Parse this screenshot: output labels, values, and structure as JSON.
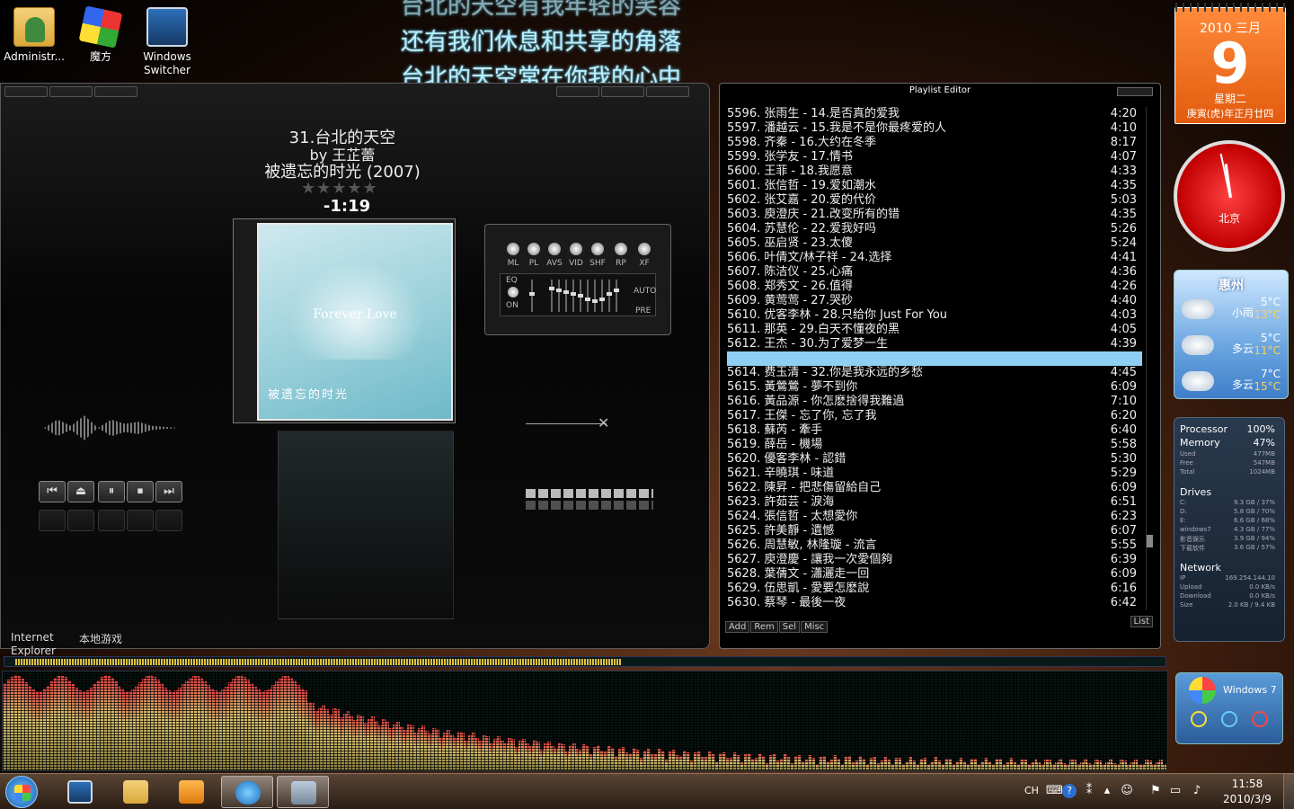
{
  "desktop": {
    "icons": [
      {
        "label": "Administr..."
      },
      {
        "label": "魔方"
      },
      {
        "label": "Windows Switcher"
      }
    ],
    "bottom_labels": {
      "ie": "Internet Explorer",
      "games": "本地游戏"
    }
  },
  "lyrics": {
    "line_prev": "台北的天空有我年轻的笑容",
    "line1": "还有我们休息和共享的角落",
    "line2": "台北的天空常在你我的心中"
  },
  "player": {
    "title": "31.台北的天空",
    "artist": "by 王芷蕾",
    "album": "被遗忘的时光 (2007)",
    "stars": "★★★★★",
    "time": "-1:19",
    "cover_title": "Forever Love",
    "cover_subtitle": "被遗忘的时光",
    "mini_labels": [
      "ML",
      "PL",
      "AVS",
      "VID",
      "SHF",
      "RP",
      "XF"
    ],
    "eq_label": "EQ",
    "eq_on": "ON",
    "eq_auto": "AUTO",
    "eq_pre": "PRE",
    "controls": [
      "⏮",
      "⏏",
      "⏸",
      "⏹",
      "⏭"
    ]
  },
  "playlist": {
    "title": "Playlist Editor",
    "items": [
      {
        "t": "5596. 张雨生 - 14.是否真的爱我",
        "d": "4:20"
      },
      {
        "t": "5597. 潘越云 - 15.我是不是你最疼爱的人",
        "d": "4:10"
      },
      {
        "t": "5598. 齐秦 - 16.大约在冬季",
        "d": "8:17"
      },
      {
        "t": "5599. 张学友 - 17.情书",
        "d": "4:07"
      },
      {
        "t": "5600. 王菲 - 18.我愿意",
        "d": "4:33"
      },
      {
        "t": "5601. 张信哲 - 19.爱如潮水",
        "d": "4:35"
      },
      {
        "t": "5602. 张艾嘉 - 20.爱的代价",
        "d": "5:03"
      },
      {
        "t": "5603. 庾澄庆 - 21.改变所有的错",
        "d": "4:35"
      },
      {
        "t": "5604. 苏慧伦 - 22.爱我好吗",
        "d": "5:26"
      },
      {
        "t": "5605. 巫启贤 - 23.太傻",
        "d": "5:24"
      },
      {
        "t": "5606. 叶倩文/林子祥 - 24.选择",
        "d": "4:41"
      },
      {
        "t": "5607. 陈洁仪 - 25.心痛",
        "d": "4:36"
      },
      {
        "t": "5608. 郑秀文 - 26.值得",
        "d": "4:26"
      },
      {
        "t": "5609. 黄莺莺 - 27.哭砂",
        "d": "4:40"
      },
      {
        "t": "5610. 优客李林 - 28.只给你 Just For You",
        "d": "4:03"
      },
      {
        "t": "5611. 那英 - 29.白天不懂夜的黑",
        "d": "4:05"
      },
      {
        "t": "5612. 王杰 - 30.为了爱梦一生",
        "d": "4:39"
      },
      {
        "t": "",
        "d": "",
        "sel": true
      },
      {
        "t": "5614. 费玉清 - 32.你是我永远的乡愁",
        "d": "4:45"
      },
      {
        "t": "5615. 黃鶯鶯 - 夢不到你",
        "d": "6:09"
      },
      {
        "t": "5616. 黃品源 - 你怎麽捨得我難過",
        "d": "7:10"
      },
      {
        "t": "5617. 王傑 - 忘了你, 忘了我",
        "d": "6:20"
      },
      {
        "t": "5618. 蘇芮 - 牽手",
        "d": "6:40"
      },
      {
        "t": "5619. 薛岳 - 機場",
        "d": "5:58"
      },
      {
        "t": "5620. 優客李林 - 認錯",
        "d": "5:30"
      },
      {
        "t": "5621. 辛曉琪 - 味道",
        "d": "5:29"
      },
      {
        "t": "5622. 陳昇 - 把悲傷留給自己",
        "d": "6:09"
      },
      {
        "t": "5623. 許茹芸 - 淚海",
        "d": "6:51"
      },
      {
        "t": "5624. 張信哲 - 太想愛你",
        "d": "6:23"
      },
      {
        "t": "5625. 許美靜 - 遺憾",
        "d": "6:07"
      },
      {
        "t": "5626. 周慧敏, 林隆璇 - 流言",
        "d": "5:55"
      },
      {
        "t": "5627. 庾澄慶 - 讓我一次愛個夠",
        "d": "6:39"
      },
      {
        "t": "5628. 葉蒨文 - 瀟灑走一回",
        "d": "6:09"
      },
      {
        "t": "5629. 伍思凱 - 愛要怎麽說",
        "d": "6:16"
      },
      {
        "t": "5630. 蔡琴 - 最後一夜",
        "d": "6:42"
      }
    ],
    "buttons": {
      "add": "Add",
      "rem": "Rem",
      "sel": "Sel",
      "misc": "Misc",
      "list": "List"
    }
  },
  "calendar": {
    "year_month": "2010 三月",
    "day": "9",
    "weekday": "星期二",
    "lunar": "庚寅(虎)年正月廿四"
  },
  "clock": {
    "city": "北京"
  },
  "weather": {
    "city": "惠州",
    "rows": [
      {
        "desc": "小雨",
        "hi": "5°C",
        "lo": "13°C"
      },
      {
        "desc": "多云",
        "hi": "5°C",
        "lo": "11°C"
      },
      {
        "desc": "多云",
        "hi": "7°C",
        "lo": "15°C"
      }
    ]
  },
  "sysmon": {
    "processor_label": "Processor",
    "processor": "100%",
    "memory_label": "Memory",
    "memory": "47%",
    "mem_rows": [
      {
        "k": "Used",
        "v": "477MB"
      },
      {
        "k": "Free",
        "v": "547MB"
      },
      {
        "k": "Total",
        "v": "1024MB"
      }
    ],
    "drives_label": "Drives",
    "drives": [
      {
        "k": "C:",
        "v": "9.3 GB / 37%"
      },
      {
        "k": "D:",
        "v": "5.8 GB / 70%"
      },
      {
        "k": "E:",
        "v": "6.6 GB / 68%"
      },
      {
        "k": "windows7",
        "v": "4.3 GB / 77%"
      },
      {
        "k": "影音娱乐",
        "v": "3.9 GB / 94%"
      },
      {
        "k": "下载软件",
        "v": "3.6 GB / 57%"
      }
    ],
    "network_label": "Network",
    "net": [
      {
        "k": "IP",
        "v": "169.254.144.10"
      },
      {
        "k": "Upload",
        "v": "0.0 KB/s"
      },
      {
        "k": "Download",
        "v": "0.0 KB/s"
      },
      {
        "k": "Size",
        "v": "2.0 KB / 9.4 KB"
      }
    ]
  },
  "win7_gadget": {
    "label": "Windows 7"
  },
  "taskbar": {
    "lang": "CH",
    "time": "11:58",
    "date": "2010/3/9"
  }
}
